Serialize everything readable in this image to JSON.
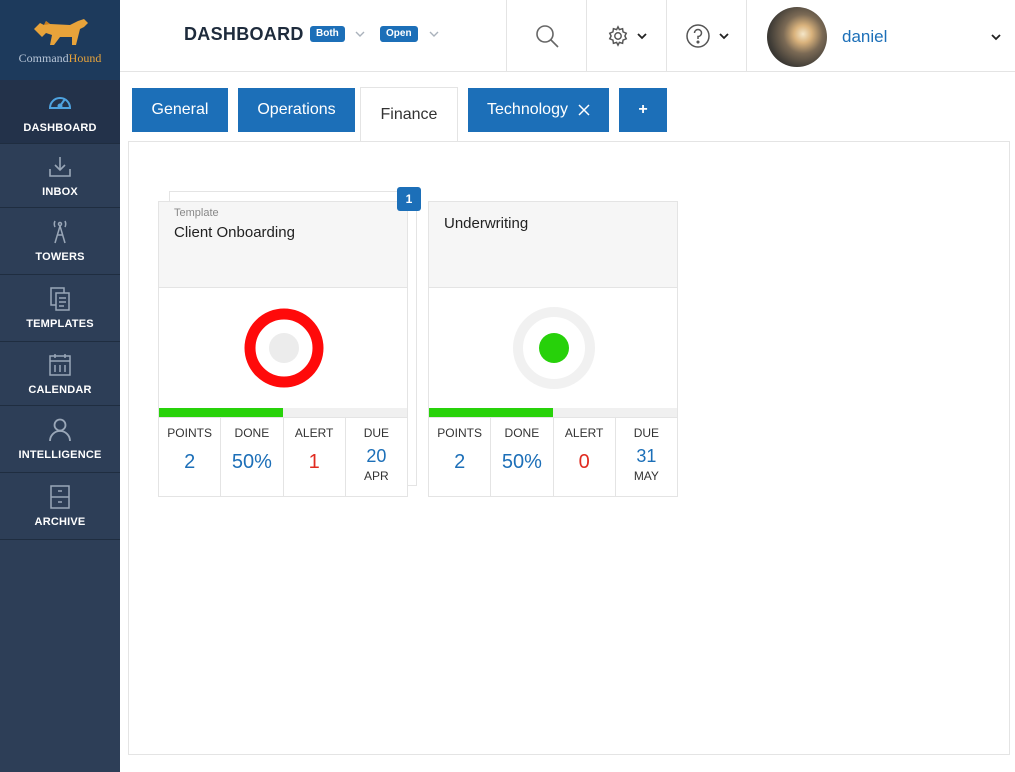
{
  "brand": {
    "logo_prefix": "Command",
    "logo_suffix": "Hound",
    "accent_color": "#1c6fb8",
    "sidebar_color": "#2d3e57"
  },
  "sidebar": {
    "items": [
      {
        "label": "DASHBOARD",
        "icon": "speedometer-icon",
        "active": true
      },
      {
        "label": "INBOX",
        "icon": "inbox-download-icon"
      },
      {
        "label": "TOWERS",
        "icon": "radio-tower-icon"
      },
      {
        "label": "TEMPLATES",
        "icon": "document-copy-icon"
      },
      {
        "label": "CALENDAR",
        "icon": "calendar-icon"
      },
      {
        "label": "INTELLIGENCE",
        "icon": "person-icon"
      },
      {
        "label": "ARCHIVE",
        "icon": "file-cabinet-icon"
      }
    ]
  },
  "header": {
    "title": "DASHBOARD",
    "filter_both": "Both",
    "filter_open": "Open",
    "user_name": "daniel"
  },
  "tabs": [
    {
      "label": "General"
    },
    {
      "label": "Operations"
    },
    {
      "label": "Finance",
      "active": true
    },
    {
      "label": "Technology",
      "closable": true
    },
    {
      "label": "+"
    }
  ],
  "cards": [
    {
      "subtitle": "Template",
      "title": "Client Onboarding",
      "stack_count": "1",
      "status": "red-ring",
      "progress": 0.5,
      "stats": {
        "points_label": "POINTS",
        "points": "2",
        "done_label": "DONE",
        "done": "50%",
        "alert_label": "ALERT",
        "alert": "1",
        "due_label": "DUE",
        "due_day": "20",
        "due_month": "APR"
      }
    },
    {
      "subtitle": "",
      "title": "Underwriting",
      "status": "green-dot",
      "progress": 0.5,
      "stats": {
        "points_label": "POINTS",
        "points": "2",
        "done_label": "DONE",
        "done": "50%",
        "alert_label": "ALERT",
        "alert": "0",
        "due_label": "DUE",
        "due_day": "31",
        "due_month": "MAY"
      }
    }
  ]
}
